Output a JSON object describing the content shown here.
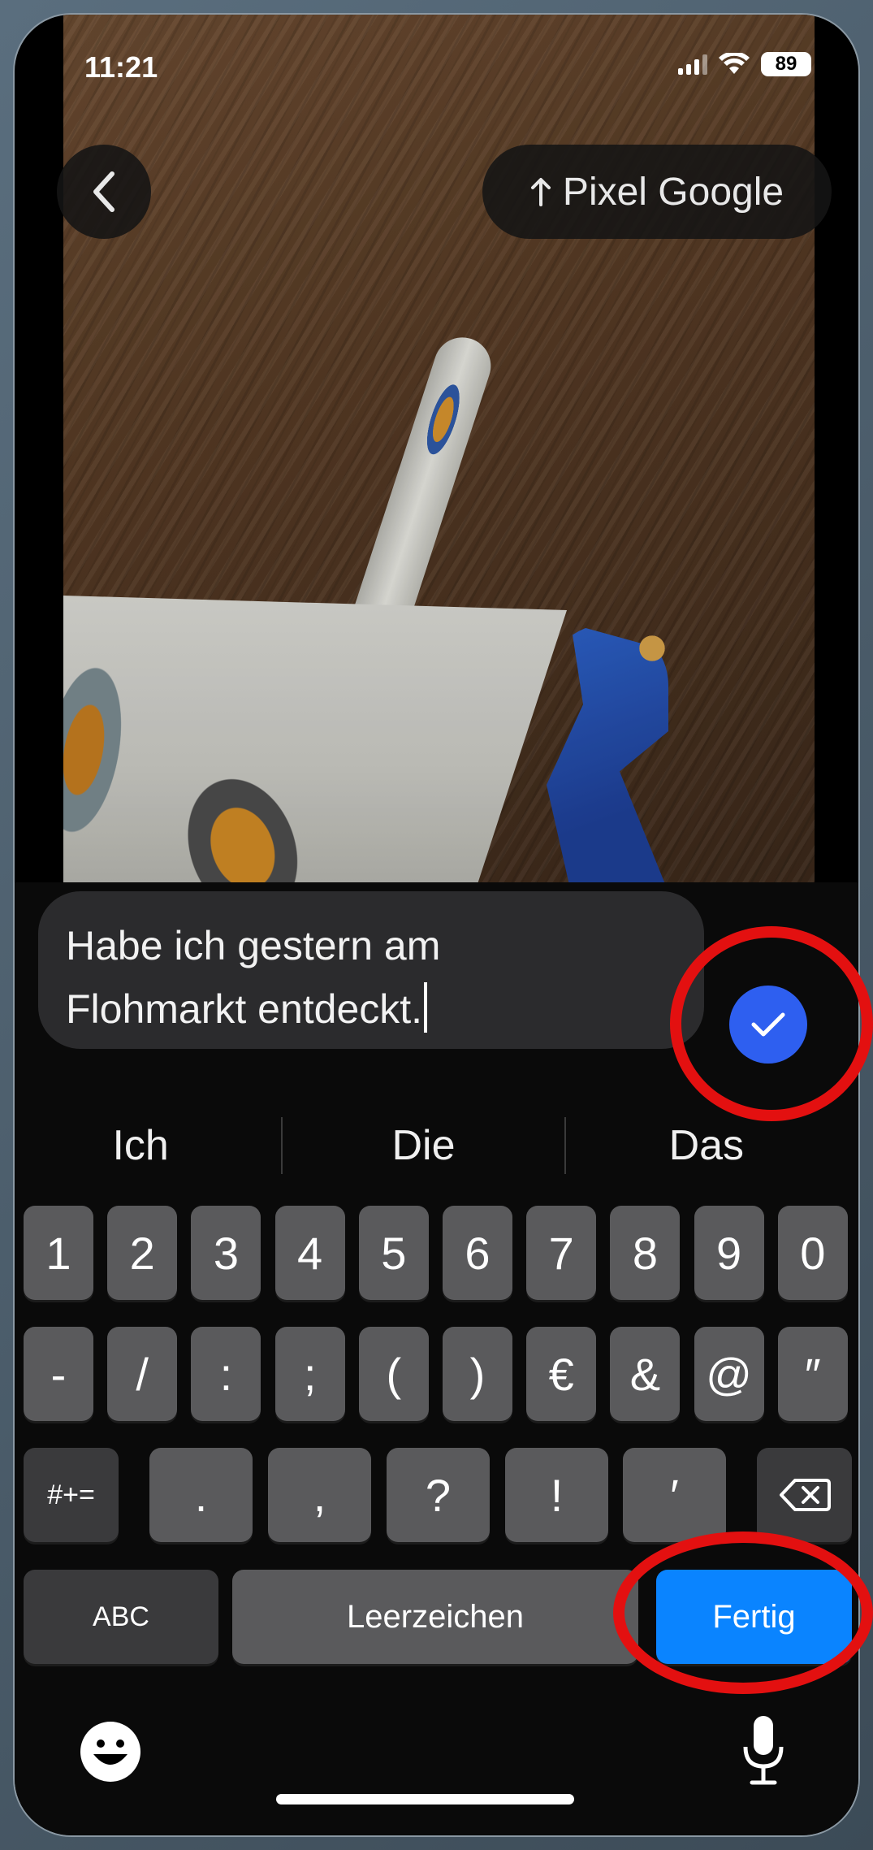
{
  "status_bar": {
    "time": "11:21",
    "battery": "89"
  },
  "header": {
    "share_label": "Pixel Google"
  },
  "caption": {
    "lines": [
      "Habe ich gestern am",
      "Flohmarkt entdeckt."
    ]
  },
  "suggestions": [
    "Ich",
    "Die",
    "Das"
  ],
  "keyboard": {
    "row1": [
      "1",
      "2",
      "3",
      "4",
      "5",
      "6",
      "7",
      "8",
      "9",
      "0"
    ],
    "row2": [
      "-",
      "/",
      ":",
      ";",
      "(",
      ")",
      "€",
      "&",
      "@",
      "″"
    ],
    "row3_mode": "#+=",
    "row3": [
      ".",
      ",",
      "?",
      "!",
      "′"
    ],
    "abc_label": "ABC",
    "space_label": "Leerzeichen",
    "done_label": "Fertig"
  },
  "colors": {
    "accent": "#2e5ff0",
    "done_key": "#0a84ff",
    "highlight_ring": "#e31010"
  }
}
